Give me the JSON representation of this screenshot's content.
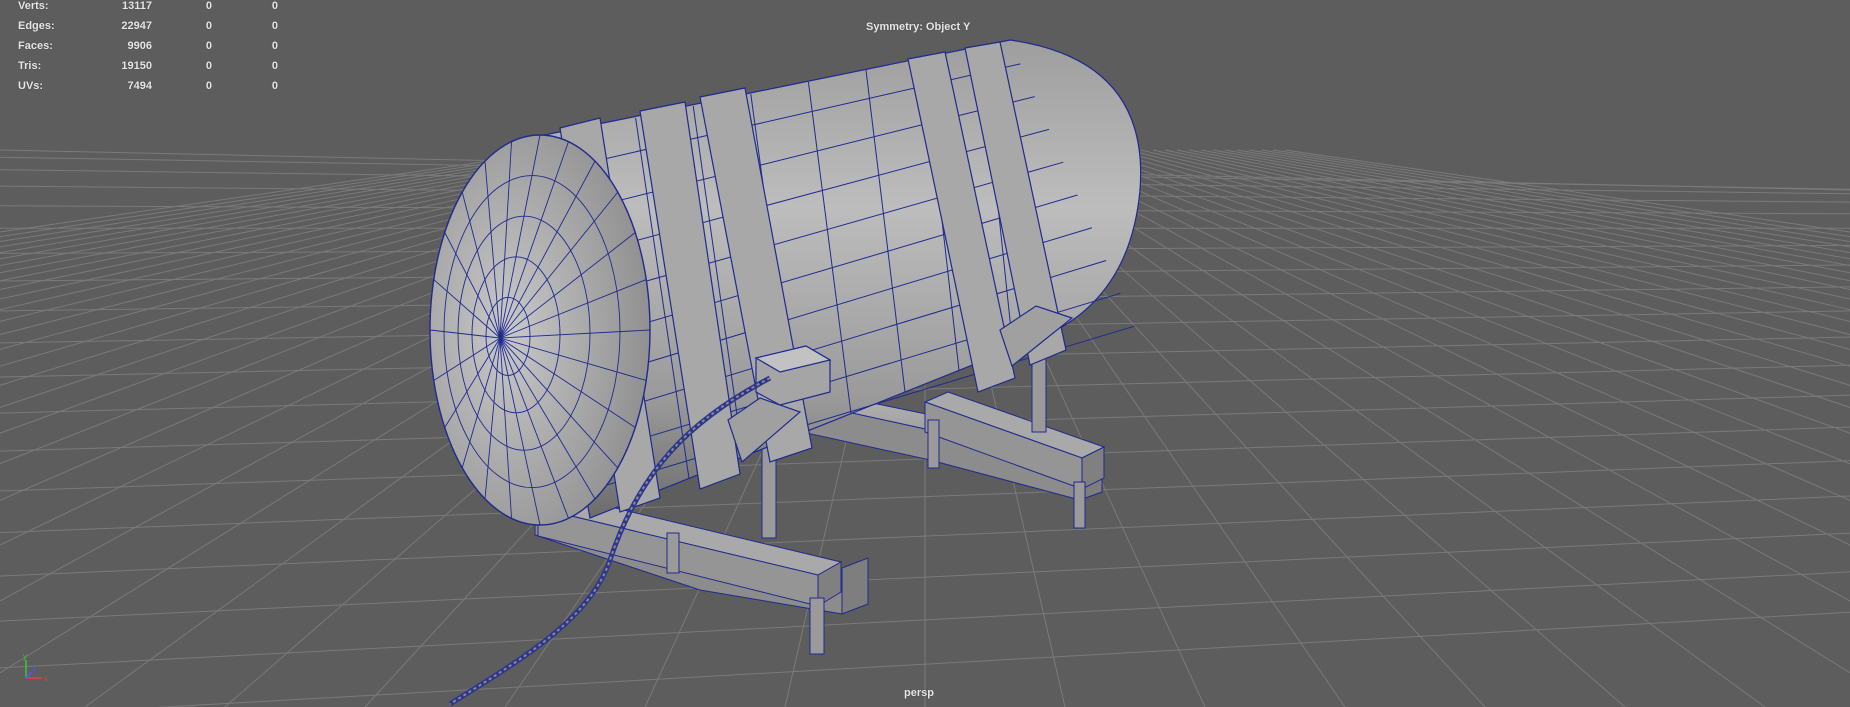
{
  "hud": {
    "stats": [
      {
        "label": "Verts:",
        "total": "13117",
        "selected": "0",
        "component": "0"
      },
      {
        "label": "Edges:",
        "total": "22947",
        "selected": "0",
        "component": "0"
      },
      {
        "label": "Faces:",
        "total": "9906",
        "selected": "0",
        "component": "0"
      },
      {
        "label": "Tris:",
        "total": "19150",
        "selected": "0",
        "component": "0"
      },
      {
        "label": "UVs:",
        "total": "7494",
        "selected": "0",
        "component": "0"
      }
    ],
    "symmetry": "Symmetry: Object Y",
    "camera": "persp"
  },
  "axis_labels": {
    "y": "y",
    "x": "x",
    "z": "z"
  },
  "colors": {
    "viewport_bg": "#5d5d5d",
    "grid": "#7a7a7a",
    "wire": "#1f2a8f",
    "shade_light": "#b4b4b4",
    "shade_dark": "#777777",
    "hud_text": "#e6e6e6"
  }
}
